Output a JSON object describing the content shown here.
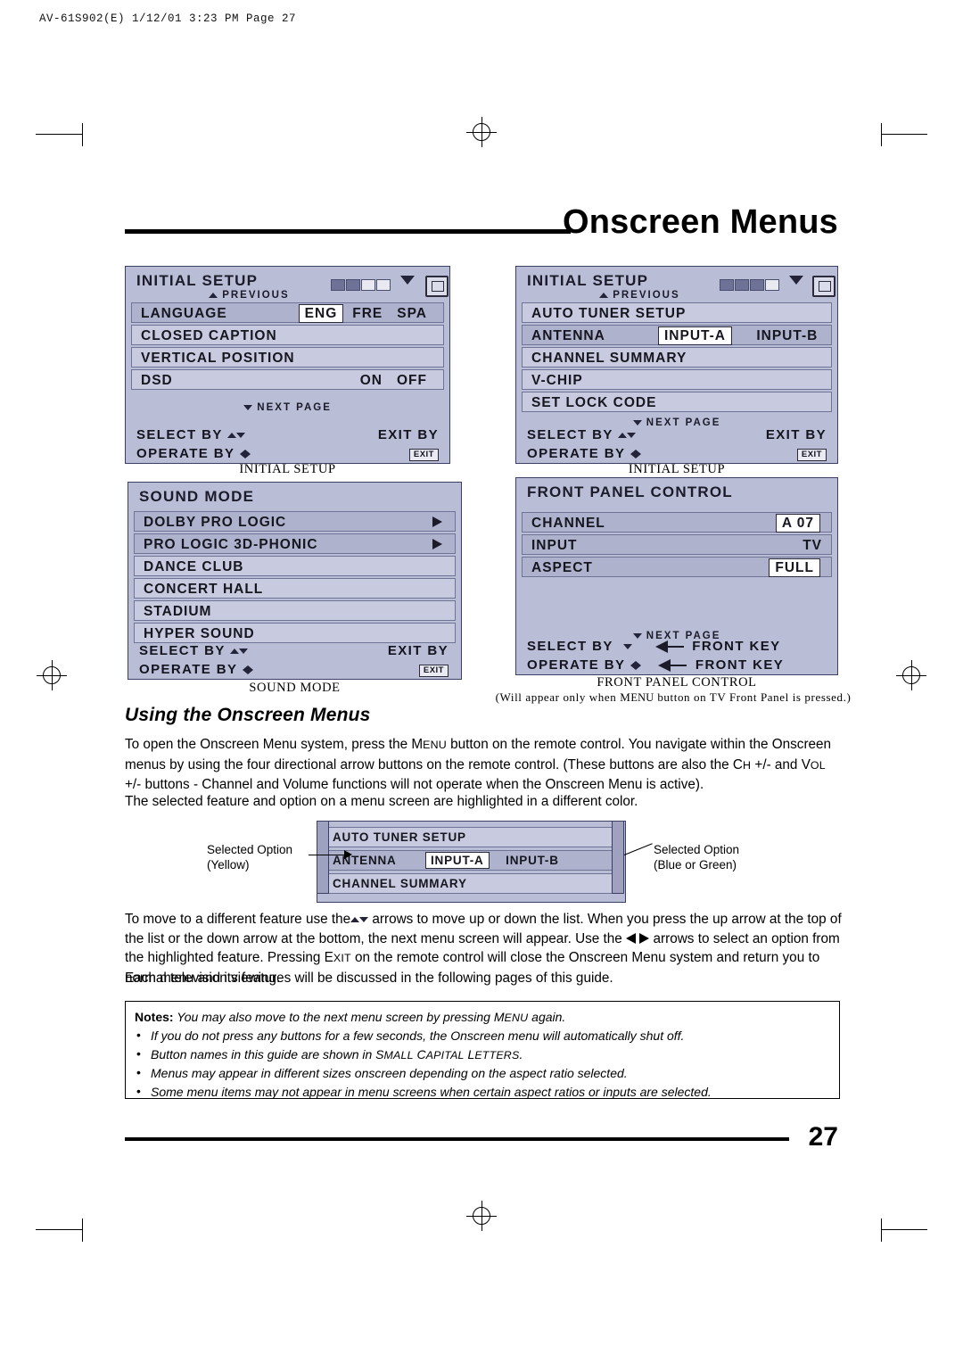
{
  "printer": {
    "header": "AV-61S902(E) 1/12/01 3:23 PM  Page 27"
  },
  "title": "Onscreen Menus",
  "page_number": "27",
  "menus": {
    "initial_setup_left": {
      "title": "INITIAL SETUP",
      "previous": "PREVIOUS",
      "rows": [
        {
          "label": "LANGUAGE",
          "values": [
            "ENG",
            "FRE",
            "SPA"
          ],
          "selected": "ENG"
        },
        {
          "label": "CLOSED CAPTION",
          "values": [],
          "selected": ""
        },
        {
          "label": "VERTICAL POSITION",
          "values": [],
          "selected": ""
        },
        {
          "label": "DSD",
          "values": [
            "ON",
            "OFF"
          ],
          "selected": "ON"
        }
      ],
      "next_page": "NEXT PAGE",
      "select": "SELECT   BY",
      "operate": "OPERATE  BY",
      "exit": "EXIT  BY",
      "exit_key": "EXIT",
      "caption": "INITIAL SETUP"
    },
    "initial_setup_right": {
      "title": "INITIAL SETUP",
      "previous": "PREVIOUS",
      "rows": [
        {
          "label": "AUTO TUNER SETUP",
          "values": [],
          "selected": ""
        },
        {
          "label": "ANTENNA",
          "values": [
            "INPUT-A",
            "INPUT-B"
          ],
          "selected": "INPUT-A"
        },
        {
          "label": "CHANNEL SUMMARY",
          "values": [],
          "selected": ""
        },
        {
          "label": "V-CHIP",
          "values": [],
          "selected": ""
        },
        {
          "label": "SET LOCK CODE",
          "values": [],
          "selected": ""
        }
      ],
      "next_page": "NEXT PAGE",
      "select": "SELECT   BY",
      "operate": "OPERATE  BY",
      "exit": "EXIT  BY",
      "exit_key": "EXIT",
      "caption": "INITIAL SETUP"
    },
    "sound_mode": {
      "title": "SOUND MODE",
      "rows": [
        {
          "label": "DOLBY PRO LOGIC",
          "arrow": true
        },
        {
          "label": "PRO LOGIC 3D-PHONIC",
          "arrow": true
        },
        {
          "label": "DANCE CLUB",
          "arrow": false
        },
        {
          "label": "CONCERT HALL",
          "arrow": false
        },
        {
          "label": "STADIUM",
          "arrow": false
        },
        {
          "label": "HYPER SOUND",
          "arrow": false
        }
      ],
      "select": "SELECT   BY",
      "operate": "OPERATE  BY",
      "exit": "EXIT  BY",
      "exit_key": "EXIT",
      "caption": "SOUND MODE"
    },
    "front_panel_control": {
      "title": "FRONT PANEL CONTROL",
      "rows": [
        {
          "label": "CHANNEL",
          "value": "A  07",
          "boxed": true
        },
        {
          "label": "INPUT",
          "value": "TV",
          "boxed": false
        },
        {
          "label": "ASPECT",
          "value": "FULL",
          "boxed": true
        }
      ],
      "next_page": "NEXT PAGE",
      "select": "SELECT   BY",
      "operate": "OPERATE  BY",
      "front_key_1": "FRONT KEY",
      "front_key_2": "FRONT KEY",
      "caption": "FRONT PANEL CONTROL",
      "caption_note": "(Will appear only when M",
      "caption_note_sc": "ENU",
      "caption_note_end": " button on TV Front Panel is pressed.)"
    }
  },
  "section": {
    "heading": "Using the Onscreen Menus",
    "p1_a": "To open the Onscreen Menu system, press the M",
    "p1_sc1": "ENU",
    "p1_b": " button on the remote control. You navigate within the",
    "p1_c": "Onscreen menus by using the four directional arrow buttons on the remote control. (These buttons are also the C",
    "p1_sc2": "H",
    "p1_d": "+/- and V",
    "p1_sc3": "OL",
    "p1_e": " +/- buttons - Channel and Volume functions will not operate when the Onscreen Menu is active).",
    "p2": "The selected feature and option on a menu screen are highlighted in a different color.",
    "p3_a": "To move to a different feature use the",
    "p3_b": " arrows to move up or down the list. When you press the up arrow at",
    "p3_c": "the top of the list or the down arrow at the bottom, the next menu screen will appear. Use the",
    "p3_d": "arrows to",
    "p3_e": "select an option from the highlighted feature. Pressing E",
    "p3_sc": "XIT",
    "p3_f": " on the remote control will close the Onscreen Menu",
    "p3_g": "system and return you to normal television viewing.",
    "p4": "Each menu and its features will be discussed in the following pages of this guide."
  },
  "example": {
    "rows": [
      {
        "label": "AUTO TUNER SETUP",
        "hl": false
      },
      {
        "label": "ANTENNA",
        "hl": true,
        "values": [
          "INPUT-A",
          "INPUT-B"
        ],
        "selected": "INPUT-A"
      },
      {
        "label": "CHANNEL SUMMARY",
        "hl": false
      }
    ],
    "left_label_1": "Selected Option",
    "left_label_2": "(Yellow)",
    "right_label_1": "Selected Option",
    "right_label_2": "(Blue or Green)"
  },
  "notes": {
    "label": "Notes:",
    "intro_a": "You may also move to the next menu screen by pressing M",
    "intro_sc": "ENU",
    "intro_b": " again.",
    "items": [
      {
        "a": "If you do not press any buttons for a few seconds, the Onscreen menu will automatically shut off.",
        "sc": "",
        "b": ""
      },
      {
        "a": "Button names in this guide are shown in S",
        "sc": "MALL",
        "b": " C",
        "sc2": "APITAL",
        "c": " L",
        "sc3": "ETTERS",
        "d": "."
      },
      {
        "a": "Menus may appear in different sizes onscreen depending on the aspect ratio selected.",
        "sc": "",
        "b": ""
      },
      {
        "a": "Some menu items may not appear in menu screens when certain aspect ratios or inputs are selected.",
        "sc": "",
        "b": ""
      }
    ]
  }
}
